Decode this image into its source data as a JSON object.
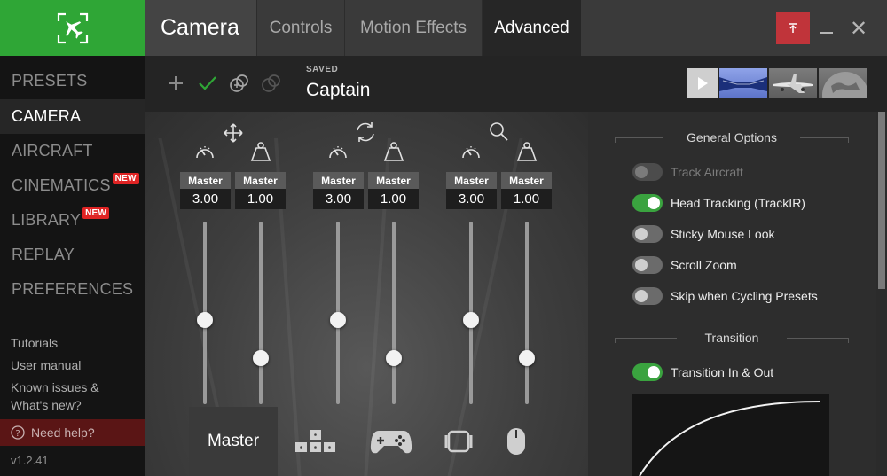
{
  "sidebar": {
    "items": [
      {
        "label": "PRESETS",
        "active": false,
        "badge": ""
      },
      {
        "label": "CAMERA",
        "active": true,
        "badge": ""
      },
      {
        "label": "AIRCRAFT",
        "active": false,
        "badge": ""
      },
      {
        "label": "CINEMATICS",
        "active": false,
        "badge": "NEW"
      },
      {
        "label": "LIBRARY",
        "active": false,
        "badge": "NEW"
      },
      {
        "label": "REPLAY",
        "active": false,
        "badge": ""
      },
      {
        "label": "PREFERENCES",
        "active": false,
        "badge": ""
      }
    ],
    "links": [
      "Tutorials",
      "User manual",
      "Known issues &",
      "What's new?"
    ],
    "help": "Need help?",
    "version": "v1.2.41"
  },
  "header": {
    "title": "Camera",
    "tabs": [
      {
        "label": "Controls",
        "active": false
      },
      {
        "label": "Motion Effects",
        "active": false
      },
      {
        "label": "Advanced",
        "active": true
      }
    ],
    "close_glyph": "✕"
  },
  "preset": {
    "saved_label": "SAVED",
    "name": "Captain"
  },
  "sliders": {
    "groups": [
      {
        "icon": "move-icon",
        "speed": {
          "head": "Master",
          "value": "3.00",
          "level": 0.46
        },
        "smooth": {
          "head": "Master",
          "value": "1.00",
          "level": 0.23
        }
      },
      {
        "icon": "rotate-icon",
        "speed": {
          "head": "Master",
          "value": "3.00",
          "level": 0.46
        },
        "smooth": {
          "head": "Master",
          "value": "1.00",
          "level": 0.23
        }
      },
      {
        "icon": "zoom-icon",
        "speed": {
          "head": "Master",
          "value": "3.00",
          "level": 0.46
        },
        "smooth": {
          "head": "Master",
          "value": "1.00",
          "level": 0.23
        }
      }
    ],
    "device_tabs": [
      {
        "label": "Master",
        "icon": "",
        "active": true
      },
      {
        "label": "",
        "icon": "keyboard-icon",
        "active": false
      },
      {
        "label": "",
        "icon": "gamepad-icon",
        "active": false
      },
      {
        "label": "",
        "icon": "trackir-icon",
        "active": false
      },
      {
        "label": "",
        "icon": "mouse-icon",
        "active": false
      }
    ]
  },
  "options": {
    "general_title": "General Options",
    "general": [
      {
        "label": "Track Aircraft",
        "on": false,
        "disabled": true
      },
      {
        "label": "Head Tracking (TrackIR)",
        "on": true,
        "disabled": false
      },
      {
        "label": "Sticky Mouse Look",
        "on": false,
        "disabled": false
      },
      {
        "label": "Scroll Zoom",
        "on": false,
        "disabled": false
      },
      {
        "label": "Skip when Cycling Presets",
        "on": false,
        "disabled": false
      }
    ],
    "transition_title": "Transition",
    "transition": [
      {
        "label": "Transition In & Out",
        "on": true,
        "disabled": false
      }
    ]
  },
  "colors": {
    "accent_green": "#2fa636",
    "toggle_on": "#3aa33f",
    "badge_red": "#e02424",
    "pin_red": "#c0343a",
    "help_bg": "#5a1515"
  }
}
